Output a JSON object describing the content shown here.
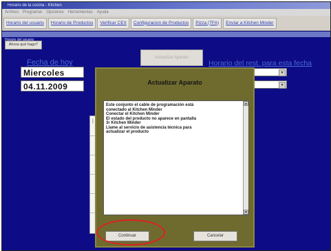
{
  "window": {
    "title": "Horario de la cocina - Kitchen",
    "menu": [
      "Archivo",
      "Programar",
      "Opciones",
      "Herramientas",
      "Ayuda"
    ]
  },
  "tabs": [
    "Horario del usuario",
    "Horario de Productos",
    "Verificar CEX",
    "Configuracion de Productos",
    "Pizza (TFA)",
    "Envíar a Kitchen Minder"
  ],
  "subbar_label": "Horario del usuario",
  "small_button": "Ahora qué hago?",
  "date_section": {
    "label": "Fecha de hoy",
    "day": "Miercoles",
    "date": "04.11.2009"
  },
  "greyed_button": "Actualizar Aparato",
  "schedule_label": "Horario del rest. para esta fecha",
  "dialog": {
    "title": "Actualizar Aparato",
    "message_lines": [
      "Este conjunto el cable de programación está",
      "conectado al Kitchen Minder",
      "Conectar el Kitchen Minder",
      "El estado del producto no aparece en pantalla",
      "3r Kitchen Minder",
      "Llame al servicio de asistencia técnica para",
      "actualizar el producto"
    ],
    "continue_button": "Continuar",
    "cancel_button": "Cancelar"
  },
  "colors": {
    "background": "#0d0c86",
    "dialog": "#6f6b2f",
    "link": "#4a6ad6",
    "highlight": "#e02020"
  }
}
